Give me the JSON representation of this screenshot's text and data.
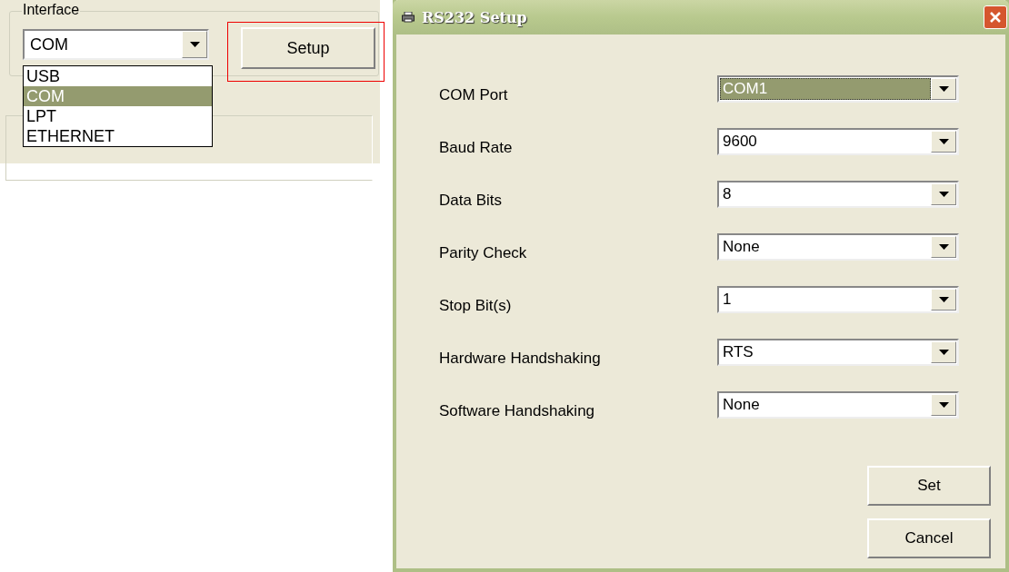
{
  "interface_panel": {
    "group_label": "Interface",
    "combo_value": "COM",
    "dropdown_open": true,
    "options": [
      {
        "label": "USB",
        "selected": false
      },
      {
        "label": "COM",
        "selected": true
      },
      {
        "label": "LPT",
        "selected": false
      },
      {
        "label": "ETHERNET",
        "selected": false
      }
    ],
    "setup_button": {
      "label": "Setup",
      "highlighted": true
    }
  },
  "dialog": {
    "title": "RS232 Setup",
    "fields": [
      {
        "label": "COM Port",
        "value": "COM1",
        "focused": true
      },
      {
        "label": "Baud Rate",
        "value": "9600",
        "focused": false
      },
      {
        "label": "Data Bits",
        "value": "8",
        "focused": false
      },
      {
        "label": "Parity Check",
        "value": "None",
        "focused": false
      },
      {
        "label": "Stop Bit(s)",
        "value": "1",
        "focused": false
      },
      {
        "label": "Hardware Handshaking",
        "value": "RTS",
        "focused": false
      },
      {
        "label": "Software Handshaking",
        "value": "None",
        "focused": false
      }
    ],
    "buttons": [
      "Set",
      "Cancel"
    ]
  }
}
